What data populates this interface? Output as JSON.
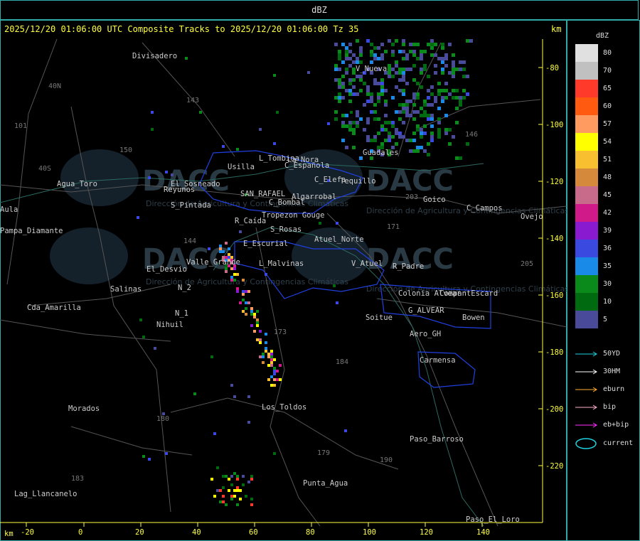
{
  "window": {
    "title": "dBZ"
  },
  "map": {
    "header": "2025/12/20 01:06:00 UTC Composite Tracks to 2025/12/20 01:06:00 Tz 35",
    "km_unit": "km",
    "x_ticks": [
      "-20",
      "0",
      "20",
      "40",
      "60",
      "80",
      "100",
      "120",
      "140"
    ],
    "y_ticks": [
      "-80",
      "-100",
      "-120",
      "-140",
      "-160",
      "-180",
      "-200",
      "-220"
    ],
    "places": [
      "Divisadero",
      "La_Nora",
      "C_Española",
      "L_Tombina",
      "Usilla",
      "C_Elefa",
      "Tequillo",
      "Goico",
      "C_Campos",
      "Agua_Toro",
      "Reyunos",
      "SAN_RAFAEL",
      "C_Bombal",
      "R_Caída",
      "S_Rosas",
      "Atuel_Norte",
      "V_Atuel",
      "R_Padre",
      "Pampa_Diamante",
      "Aula",
      "S_Pintada",
      "El_Desvio",
      "Valle_Grande",
      "L_Malvinas",
      "E_Escurial",
      "Salinas",
      "Cda_Amarilla",
      "Nihuil",
      "N_1",
      "N_2",
      "Colonia Alvear",
      "Bowen",
      "Soitue",
      "G_ALVEAR",
      "CompantEscard",
      "Aero_GH",
      "Carmensa",
      "Los_Toldos",
      "Morados",
      "Paso_Barroso",
      "Punta_Agua",
      "Lag_Llancanelo",
      "Paso_El_Loro",
      "Guadales",
      "V_Nueva",
      "Ovejo",
      "Tropezon Gouge",
      "Algarrobal",
      "El Sosneado"
    ],
    "route_numbers": [
      "143",
      "101",
      "40N",
      "150",
      "144",
      "173",
      "184",
      "180",
      "179",
      "190",
      "183",
      "171",
      "146",
      "203",
      "205",
      "40S"
    ],
    "watermark": "DACC",
    "watermark_sub": "Dirección de Agricultura y Contingencias Climáticas"
  },
  "legend": {
    "title": "dBZ",
    "levels": [
      {
        "label": "80",
        "color": "#e0e0e0"
      },
      {
        "label": "70",
        "color": "#c0c0c0"
      },
      {
        "label": "65",
        "color": "#ff3a2a"
      },
      {
        "label": "60",
        "color": "#ff5a10"
      },
      {
        "label": "57",
        "color": "#ff9a60"
      },
      {
        "label": "54",
        "color": "#ffff00"
      },
      {
        "label": "51",
        "color": "#f8c030"
      },
      {
        "label": "48",
        "color": "#d48a3a"
      },
      {
        "label": "45",
        "color": "#c86a8a"
      },
      {
        "label": "42",
        "color": "#d01a8a"
      },
      {
        "label": "39",
        "color": "#8a1ad0"
      },
      {
        "label": "36",
        "color": "#3a4ae0"
      },
      {
        "label": "35",
        "color": "#1a8ae8"
      },
      {
        "label": "30",
        "color": "#0a8a1a"
      },
      {
        "label": "10",
        "color": "#006a10"
      },
      {
        "label": "5",
        "color": "#4a4a9a"
      }
    ],
    "tracks": [
      {
        "label": "50YD",
        "color": "#20d0e0"
      },
      {
        "label": "30HM",
        "color": "#ffffff"
      },
      {
        "label": "eburn",
        "color": "#ffb030"
      },
      {
        "label": "bip",
        "color": "#ffb0d0"
      },
      {
        "label": "eb+bip",
        "color": "#ff30ff"
      }
    ],
    "current_label": "current",
    "current_color": "#20d0e0"
  }
}
